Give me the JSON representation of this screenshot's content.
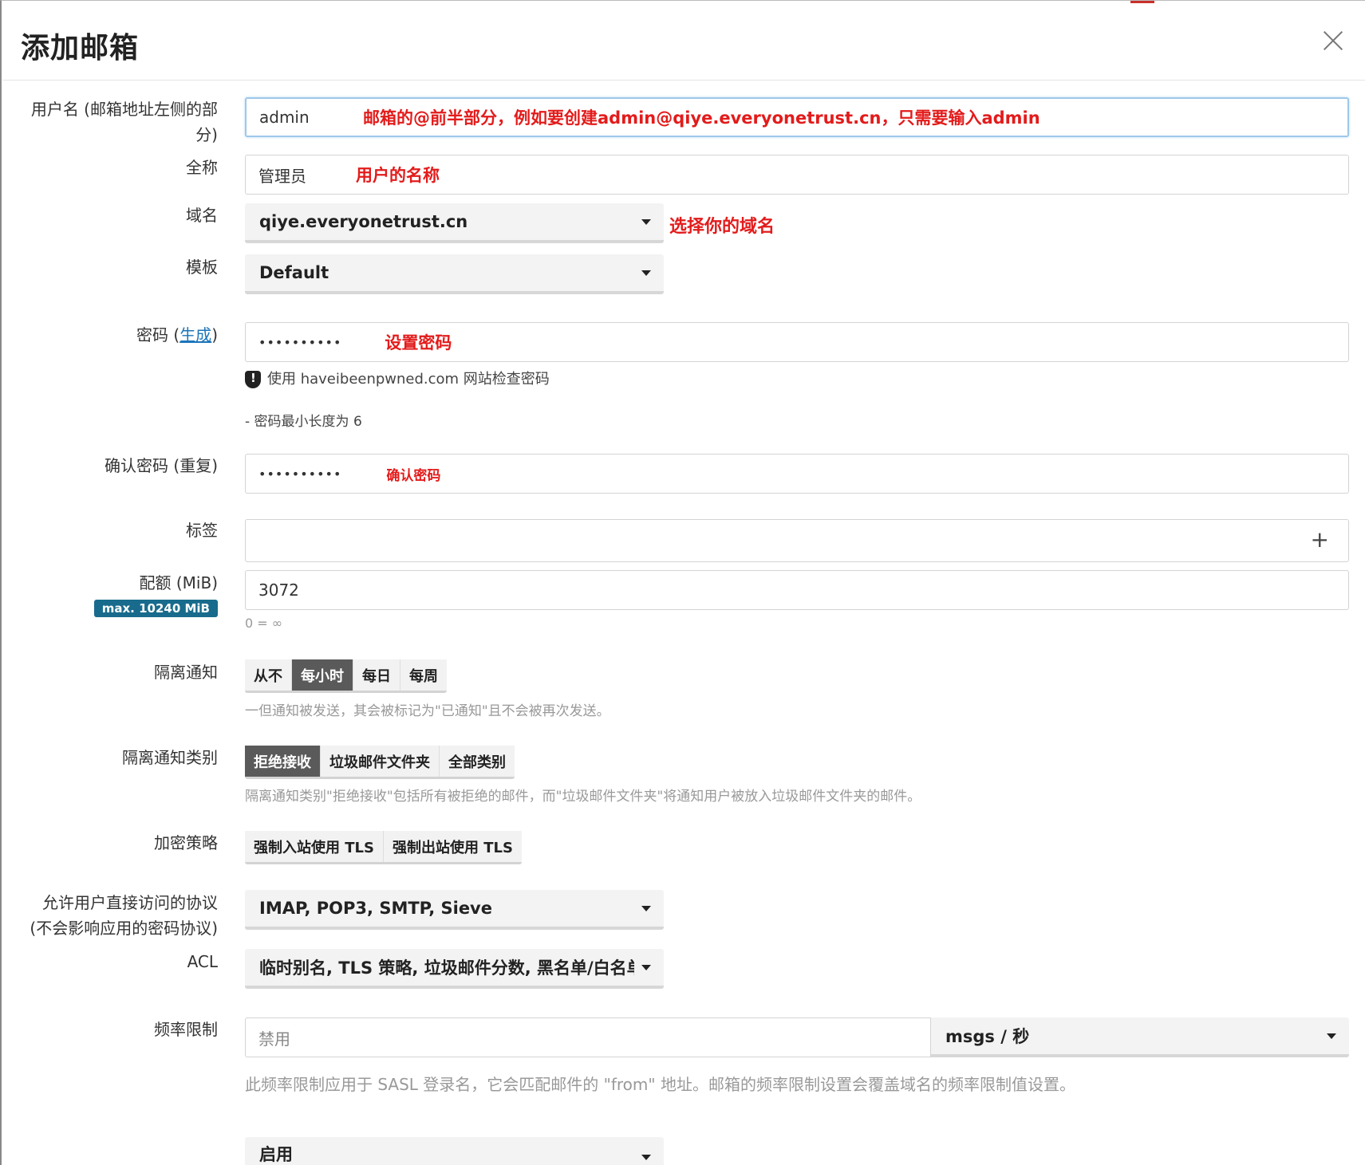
{
  "dialog": {
    "title": "添加邮箱"
  },
  "fields": {
    "username": {
      "label": "用户名 (邮箱地址左侧的部",
      "label2": "分)",
      "value": "admin",
      "note": "邮箱的@前半部分，例如要创建admin@qiye.everyonetrust.cn，只需要输入admin"
    },
    "fullname": {
      "label": "全称",
      "value": "管理员",
      "note": "用户的名称"
    },
    "domain": {
      "label": "域名",
      "value": "qiye.everyonetrust.cn",
      "note": "选择你的域名"
    },
    "template": {
      "label": "模板",
      "value": "Default"
    },
    "password": {
      "label_prefix": "密码 (",
      "generate_link": "生成",
      "label_suffix": ")",
      "value": "••••••••••",
      "note": "设置密码",
      "pwned_check": "使用 haveibeenpwned.com 网站检查密码",
      "min_length_hint": "- 密码最小长度为 6"
    },
    "password_confirm": {
      "label": "确认密码 (重复)",
      "value": "••••••••••",
      "note": "确认密码"
    },
    "tags": {
      "label": "标签",
      "add_icon": "+"
    },
    "quota": {
      "label": "配额 (MiB)",
      "badge": "max. 10240 MiB",
      "value": "3072",
      "hint": "0 = ∞"
    },
    "quarantine_notification": {
      "label": "隔离通知",
      "options": [
        "从不",
        "每小时",
        "每日",
        "每周"
      ],
      "selected": "每小时",
      "hint": "一但通知被发送，其会被标记为\"已通知\"且不会被再次发送。"
    },
    "quarantine_category": {
      "label": "隔离通知类别",
      "options": [
        "拒绝接收",
        "垃圾邮件文件夹",
        "全部类别"
      ],
      "selected": "拒绝接收",
      "hint": "隔离通知类别\"拒绝接收\"包括所有被拒绝的邮件，而\"垃圾邮件文件夹\"将通知用户被放入垃圾邮件文件夹的邮件。"
    },
    "encryption_policy": {
      "label": "加密策略",
      "options": [
        "强制入站使用 TLS",
        "强制出站使用 TLS"
      ]
    },
    "protocols": {
      "label": "允许用户直接访问的协议",
      "label2": "(不会影响应用的密码协议)",
      "value": "IMAP, POP3, SMTP, Sieve"
    },
    "acl": {
      "label": "ACL",
      "value": "临时别名, TLS 策略, 垃圾邮件分数, 黑名单/白名单,"
    },
    "rate_limit": {
      "label": "频率限制",
      "placeholder": "禁用",
      "unit": "msgs / 秒",
      "hint": "此频率限制应用于 SASL 登录名，它会匹配邮件的 \"from\" 地址。邮箱的频率限制设置会覆盖域名的频率限制值设置。"
    },
    "active": {
      "value": "启用"
    }
  },
  "colors": {
    "annotation": "#e31b1b",
    "badge": "#186b8c",
    "active_button": "#5a5a5a",
    "link": "#1b75bb"
  }
}
